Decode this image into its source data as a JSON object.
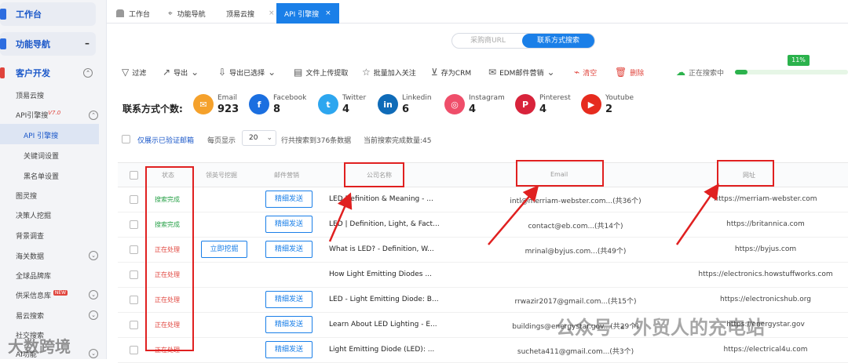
{
  "sidebar": {
    "group_workbench": "工作台",
    "group_nav": "功能导航",
    "nav_collapse": "–",
    "group_customer": "客户开发",
    "items": {
      "yunsou": "顶易云搜",
      "api_engine": "API引擎搜",
      "api_version": "V7.0",
      "api_engine_sub": "API 引擎搜",
      "keyword_settings": "关键词设置",
      "blacklist": "黑名单设置",
      "tulingsou": "图灵搜",
      "decision_maker": "决策人挖掘",
      "background_check": "背景调查",
      "customs": "海关数据",
      "global_brands": "全球品牌库",
      "supplier_info": "供采信息库",
      "new_badge": "NEW",
      "yiyun": "易云搜索",
      "social": "社交搜索",
      "ai": "AI功能"
    }
  },
  "tabs": [
    {
      "label": "工作台"
    },
    {
      "label": "功能导航"
    },
    {
      "label": "顶易云搜"
    },
    {
      "label": "API 引擎搜"
    }
  ],
  "toggle": {
    "option1": "采购商URL",
    "option2": "联系方式搜索"
  },
  "toolbar": {
    "filter": "过滤",
    "export": "导出",
    "export_selected": "导出已选择",
    "upload": "文件上传提取",
    "batch_follow": "批量加入关注",
    "save_crm": "存为CRM",
    "edm": "EDM邮件营销",
    "clear": "清空",
    "delete": "删除",
    "searching": "正在搜索中",
    "progress_pct": "11%",
    "progress_value": 0.11
  },
  "contacts": {
    "title": "联系方式个数:",
    "items": [
      {
        "label": "Email",
        "count": "923",
        "icon": "email-icon",
        "color": "#f5a12b"
      },
      {
        "label": "Facebook",
        "count": "8",
        "icon": "facebook-icon",
        "color": "#1b6fe0"
      },
      {
        "label": "Twitter",
        "count": "4",
        "icon": "twitter-icon",
        "color": "#2da6ef"
      },
      {
        "label": "Linkedin",
        "count": "6",
        "icon": "linkedin-icon",
        "color": "#0f6bb8"
      },
      {
        "label": "Instagram",
        "count": "4",
        "icon": "instagram-icon",
        "color": "#ef4e6a"
      },
      {
        "label": "Pinterest",
        "count": "4",
        "icon": "pinterest-icon",
        "color": "#d8233b"
      },
      {
        "label": "Youtube",
        "count": "2",
        "icon": "youtube-icon",
        "color": "#e62b1e"
      }
    ]
  },
  "filters": {
    "show_verified": "仅展示已验证邮箱",
    "per_page": "每页显示",
    "per_page_value": "20",
    "total": "行共搜索到376条数据",
    "completed": "当前搜索完成数量:45"
  },
  "table": {
    "headers": [
      "状态",
      "领英号挖掘",
      "邮件营销",
      "公司名称",
      "Email",
      "网址"
    ],
    "rows": [
      {
        "status": "搜索完成",
        "status_type": "done",
        "mine": "",
        "mail_btn": "精细发送",
        "company": "LED Definition & Meaning - ...",
        "email": "intl@merriam-webster.com...(共36个)",
        "url": "https://merriam-webster.com"
      },
      {
        "status": "搜索完成",
        "status_type": "done",
        "mine": "",
        "mail_btn": "精细发送",
        "company": "LED | Definition, Light, & Fact...",
        "email": "contact@eb.com...(共14个)",
        "url": "https://britannica.com"
      },
      {
        "status": "正在处理",
        "status_type": "proc",
        "mine": "立即挖掘",
        "mail_btn": "精细发送",
        "company": "What is LED? - Definition, W...",
        "email": "mrinal@byjus.com...(共49个)",
        "url": "https://byjus.com"
      },
      {
        "status": "正在处理",
        "status_type": "proc",
        "mine": "",
        "mail_btn": "",
        "company": "How Light Emitting Diodes ...",
        "email": "",
        "url": "https://electronics.howstuffworks.com"
      },
      {
        "status": "正在处理",
        "status_type": "proc",
        "mine": "",
        "mail_btn": "精细发送",
        "company": "LED - Light Emitting Diode: B...",
        "email": "rrwazir2017@gmail.com...(共15个)",
        "url": "https://electronicshub.org"
      },
      {
        "status": "正在处理",
        "status_type": "proc",
        "mine": "",
        "mail_btn": "精细发送",
        "company": "Learn About LED Lighting - E...",
        "email": "buildings@energystar.gov...(共29个)",
        "url": "https://energystar.gov"
      },
      {
        "status": "正在处理",
        "status_type": "proc",
        "mine": "",
        "mail_btn": "精细发送",
        "company": "Light Emitting Diode (LED): ...",
        "email": "sucheta411@gmail.com...(共3个)",
        "url": "https://electrical4u.com"
      }
    ]
  },
  "watermarks": {
    "left": "大数跨境",
    "right": "公众号 · 外贸人的充电站"
  }
}
